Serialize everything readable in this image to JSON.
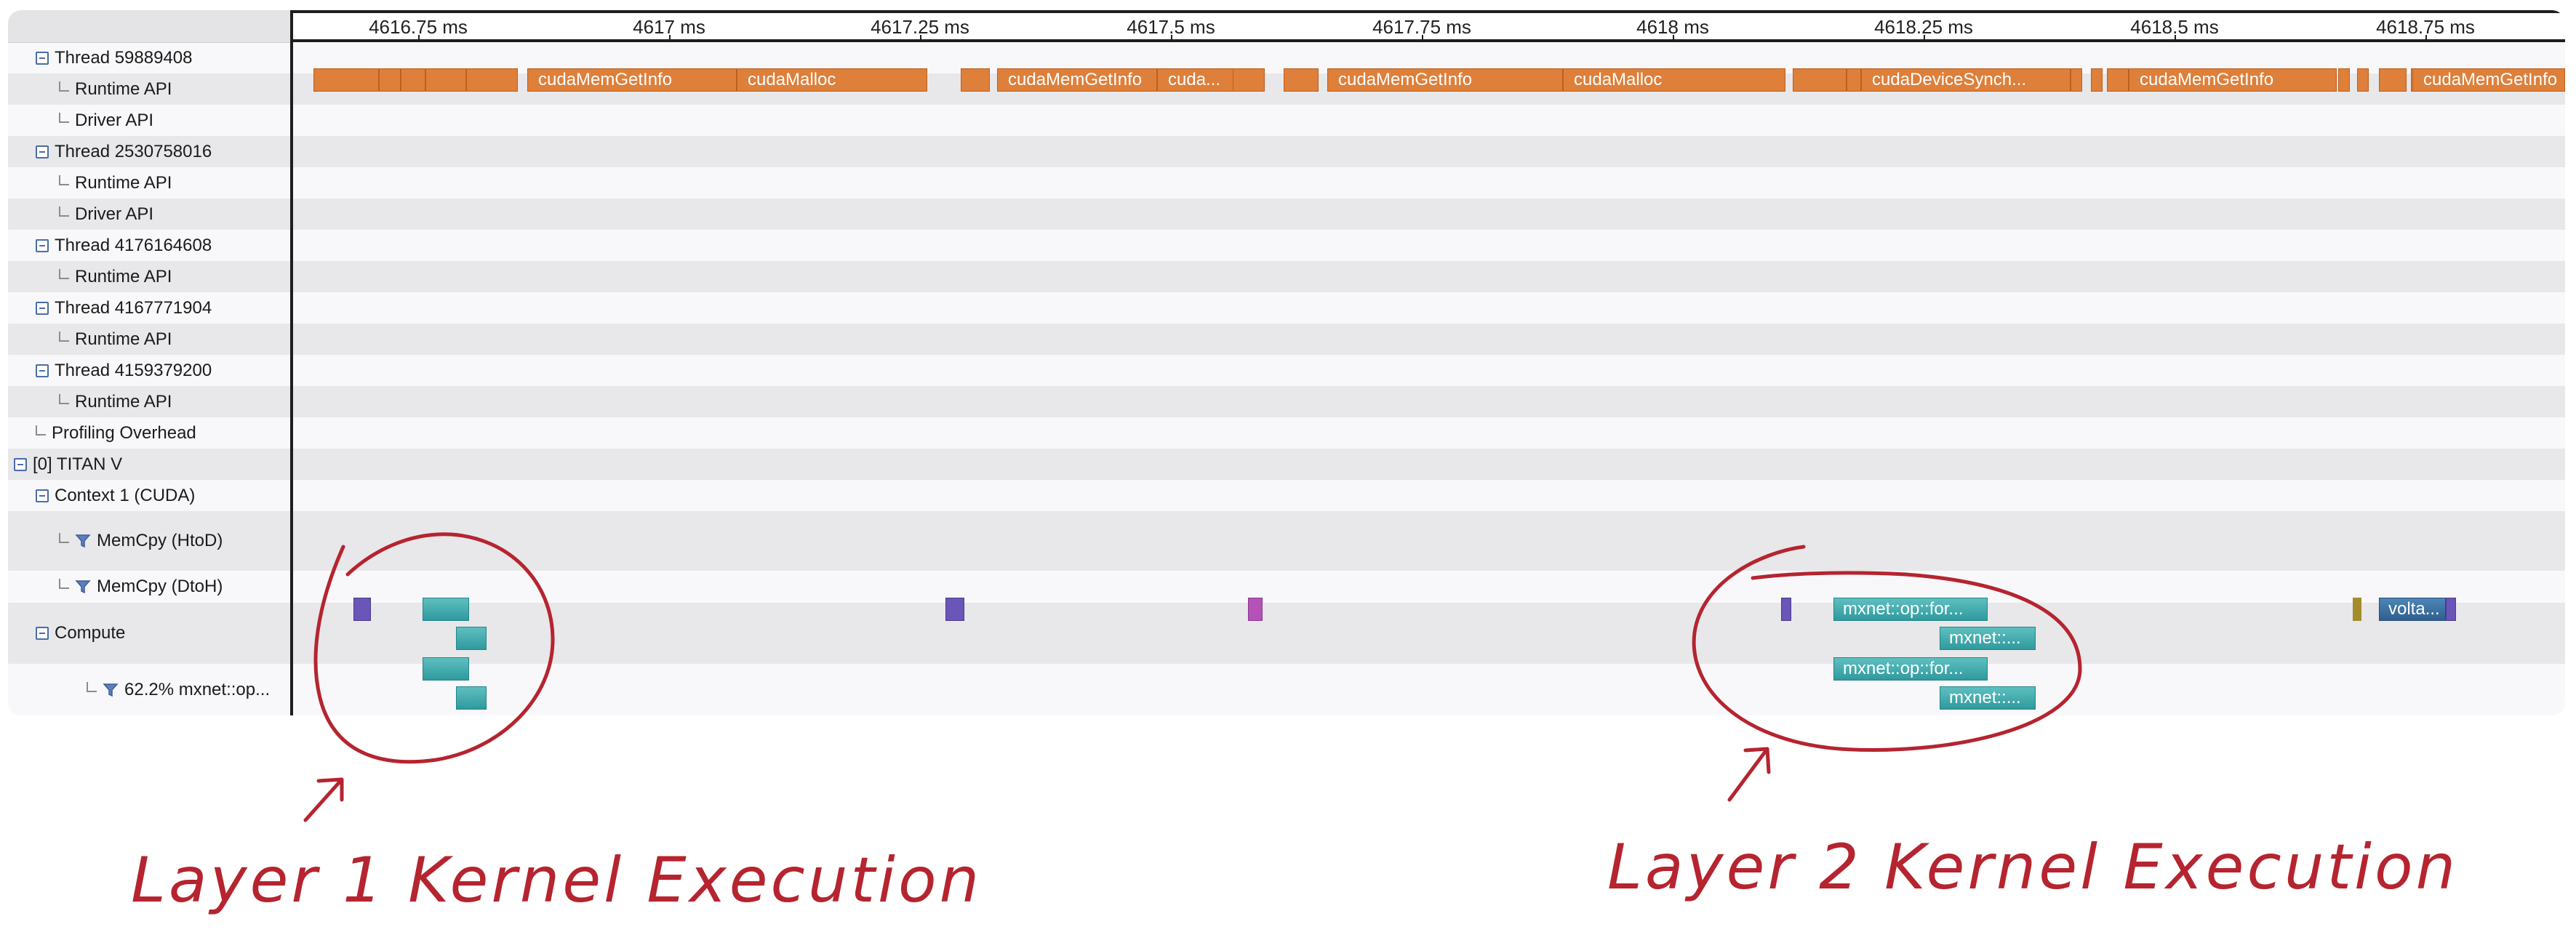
{
  "ruler": {
    "ticks": [
      "4616.75 ms",
      "4617 ms",
      "4617.25 ms",
      "4617.5 ms",
      "4617.75 ms",
      "4618 ms",
      "4618.25 ms",
      "4618.5 ms",
      "4618.75 ms"
    ]
  },
  "rows": [
    {
      "label": "Thread 59889408",
      "kind": "thread"
    },
    {
      "label": "Runtime API",
      "kind": "child"
    },
    {
      "label": "Driver API",
      "kind": "child"
    },
    {
      "label": "Thread 2530758016",
      "kind": "thread"
    },
    {
      "label": "Runtime API",
      "kind": "child"
    },
    {
      "label": "Driver API",
      "kind": "child"
    },
    {
      "label": "Thread 4176164608",
      "kind": "thread"
    },
    {
      "label": "Runtime API",
      "kind": "child"
    },
    {
      "label": "Thread 4167771904",
      "kind": "thread"
    },
    {
      "label": "Runtime API",
      "kind": "child"
    },
    {
      "label": "Thread 4159379200",
      "kind": "thread"
    },
    {
      "label": "Runtime API",
      "kind": "child"
    },
    {
      "label": "Profiling Overhead",
      "kind": "leaf"
    },
    {
      "label": "[0] TITAN V",
      "kind": "device"
    },
    {
      "label": "Context 1 (CUDA)",
      "kind": "context"
    },
    {
      "label": "MemCpy (HtoD)",
      "kind": "filter"
    },
    {
      "label": "MemCpy (DtoH)",
      "kind": "filter"
    },
    {
      "label": "Compute",
      "kind": "context"
    },
    {
      "label": "62.2% mxnet::op...",
      "kind": "filter-deep"
    }
  ],
  "runtime_api_bars": {
    "labels": {
      "b1": "cudaMemGetInfo",
      "b2": "cudaMalloc",
      "b3": "cudaMemGetInfo",
      "b4": "cuda...",
      "b5": "cudaMemGetInfo",
      "b6": "cudaMalloc",
      "b7": "cudaDeviceSynch...",
      "b8": "cudaMemGetInfo",
      "b9": "cudaMemGetInfo"
    }
  },
  "kernels": {
    "k1": "mxnet::op::for...",
    "k2": "mxnet::...",
    "k3": "mxnet::op::for...",
    "k4": "mxnet::...",
    "k5": "volta..."
  },
  "annotations": {
    "left": "Layer 1 Kernel Execution",
    "right": "Layer 2 Kernel Execution"
  },
  "colors": {
    "api_bar": "#de7f3a",
    "kernel_teal": "#3fa8ab",
    "annotation": "#b5242f"
  }
}
